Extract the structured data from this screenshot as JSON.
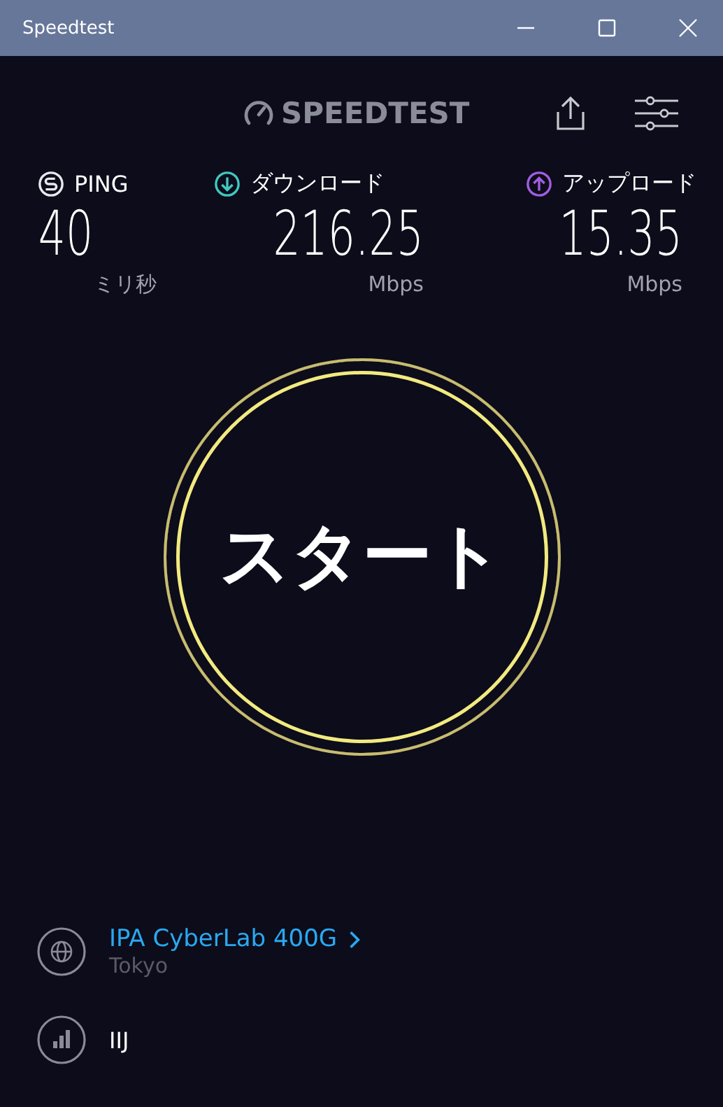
{
  "window": {
    "title": "Speedtest"
  },
  "logo": "SPEEDTEST",
  "metrics": [
    {
      "kind": "ping",
      "label": "PING",
      "value": "40",
      "unit": "ミリ秒",
      "color": "#e8e8ee"
    },
    {
      "kind": "download",
      "label": "ダウンロード",
      "value": "216.25",
      "unit": "Mbps",
      "color": "#3fc8c0"
    },
    {
      "kind": "upload",
      "label": "アップロード",
      "value": "15.35",
      "unit": "Mbps",
      "color": "#a05ee0"
    }
  ],
  "start_button": "スタート",
  "server": {
    "name": "IPA CyberLab 400G",
    "location": "Tokyo"
  },
  "provider": "IIJ"
}
